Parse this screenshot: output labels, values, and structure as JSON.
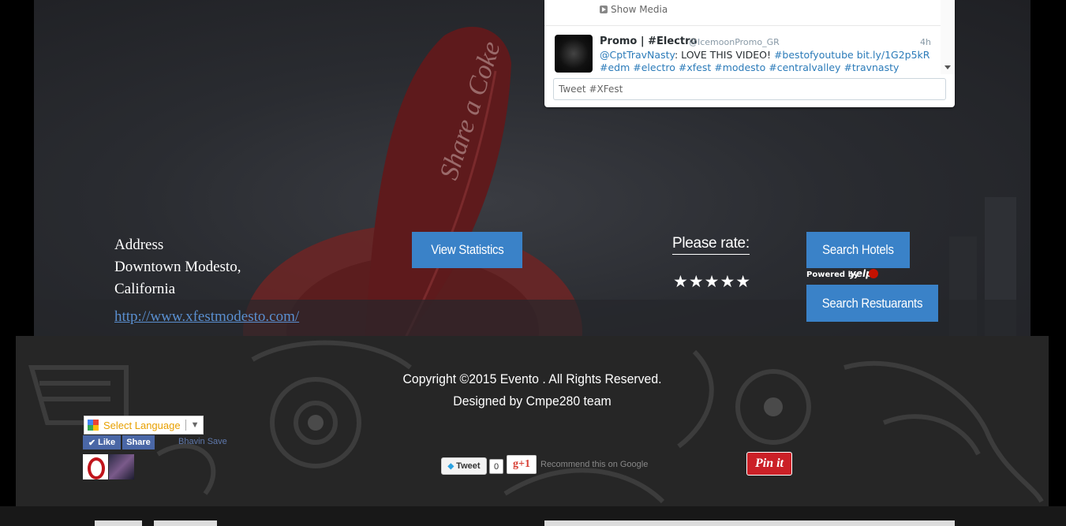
{
  "twitter": {
    "show_media": "Show Media",
    "tweet": {
      "name": "Promo | #Electro",
      "handle": "@IcemoonPromo_GR",
      "time": "4h",
      "mention": "@CptTravNasty",
      "text_plain": ": LOVE THIS VIDEO! ",
      "link1": "#bestofyoutube",
      "link2": "bit.ly/1G2p5kR",
      "tags": [
        "#edm",
        "#electro",
        "#xfest",
        "#modesto",
        "#centralvalley",
        "#travnasty"
      ]
    },
    "input_placeholder": "Tweet #XFest"
  },
  "address": {
    "label": "Address",
    "line1": "Downtown Modesto,",
    "line2": "California",
    "url": "http://www.xfestmodesto.com/"
  },
  "buttons": {
    "view_statistics": "View Statistics",
    "search_hotels": "Search Hotels",
    "search_restaurants": "Search Restuarants"
  },
  "rating": {
    "label": "Please rate:",
    "stars": "★★★★★"
  },
  "powered_by": {
    "label": "Powered by",
    "brand": "yelp"
  },
  "footer": {
    "copyright": "Copyright ©2015 Evento . All Rights Reserved.",
    "designed_by": "Designed by Cmpe280 team",
    "select_language": "Select Language",
    "fb_like": "Like",
    "fb_share": "Share",
    "fb_user": "Bhavin Save",
    "tweet_label": "Tweet",
    "tweet_count": "0",
    "gplus_label": "g+1",
    "gplus_recommend": "Recommend this on Google",
    "pinit": "Pin it"
  },
  "colors": {
    "button_blue": "#3a82c8",
    "link_blue": "#5a8fd0",
    "pinit_red": "#cb2027",
    "twitter_link": "#2b7bb9"
  }
}
